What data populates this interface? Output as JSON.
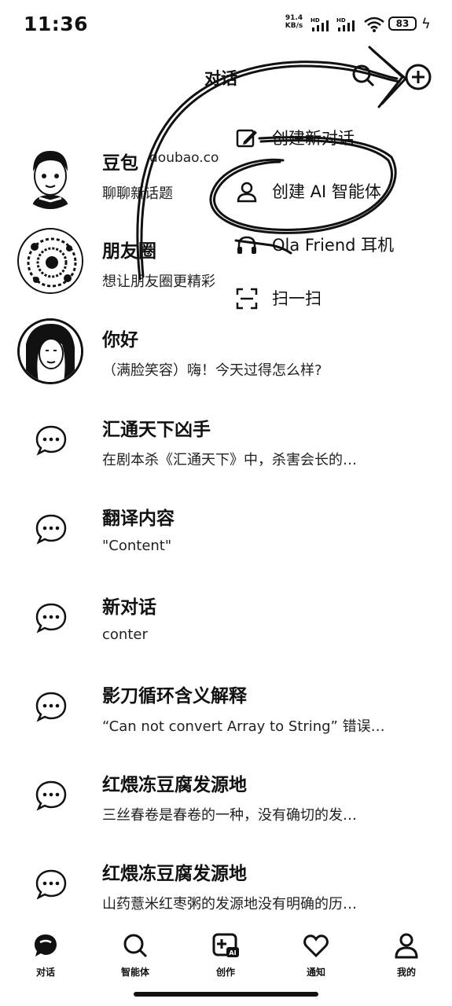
{
  "status_bar": {
    "time": "11:36",
    "net_speed": "91.4",
    "net_unit": "KB/s",
    "signal_label": "HD",
    "battery": "83"
  },
  "header": {
    "title": "对话"
  },
  "menu": {
    "items": [
      {
        "label": "创建新对话",
        "icon": "edit-icon"
      },
      {
        "label": "创建 AI 智能体",
        "icon": "user-icon"
      },
      {
        "label": "Ola Friend 耳机",
        "icon": "headphone-icon"
      },
      {
        "label": "扫一扫",
        "icon": "scan-icon"
      }
    ]
  },
  "chats": [
    {
      "title": "豆包",
      "subtitle": "聊聊新话题",
      "domain": "doubao.com",
      "avatar": "doubao-avatar"
    },
    {
      "title": "朋友圈",
      "subtitle": "想让朋友圈更精彩",
      "avatar": "circle-avatar"
    },
    {
      "title": "你好",
      "subtitle": "（满脸笑容）嗨！今天过得怎么样?",
      "avatar": "person-avatar"
    },
    {
      "title": "汇通天下凶手",
      "subtitle": "在剧本杀《汇通天下》中，杀害会长的…",
      "avatar": "chat-bubble"
    },
    {
      "title": "翻译内容",
      "subtitle": "\"Content\"",
      "avatar": "chat-bubble"
    },
    {
      "title": "新对话",
      "subtitle": "conter",
      "avatar": "chat-bubble"
    },
    {
      "title": "影刀循环含义解释",
      "subtitle": "“Can not convert Array to String” 错误…",
      "avatar": "chat-bubble"
    },
    {
      "title": "红煨冻豆腐发源地",
      "subtitle": "三丝春卷是春卷的一种，没有确切的发…",
      "avatar": "chat-bubble"
    },
    {
      "title": "红煨冻豆腐发源地",
      "subtitle": "山药薏米红枣粥的发源地没有明确的历…",
      "avatar": "chat-bubble"
    }
  ],
  "tabbar": {
    "tabs": [
      {
        "label": "对话",
        "icon": "chat-icon"
      },
      {
        "label": "智能体",
        "icon": "search-icon"
      },
      {
        "label": "创作",
        "icon": "create-ai-icon",
        "badge": "AI"
      },
      {
        "label": "通知",
        "icon": "heart-icon"
      },
      {
        "label": "我的",
        "icon": "person-icon"
      }
    ]
  }
}
